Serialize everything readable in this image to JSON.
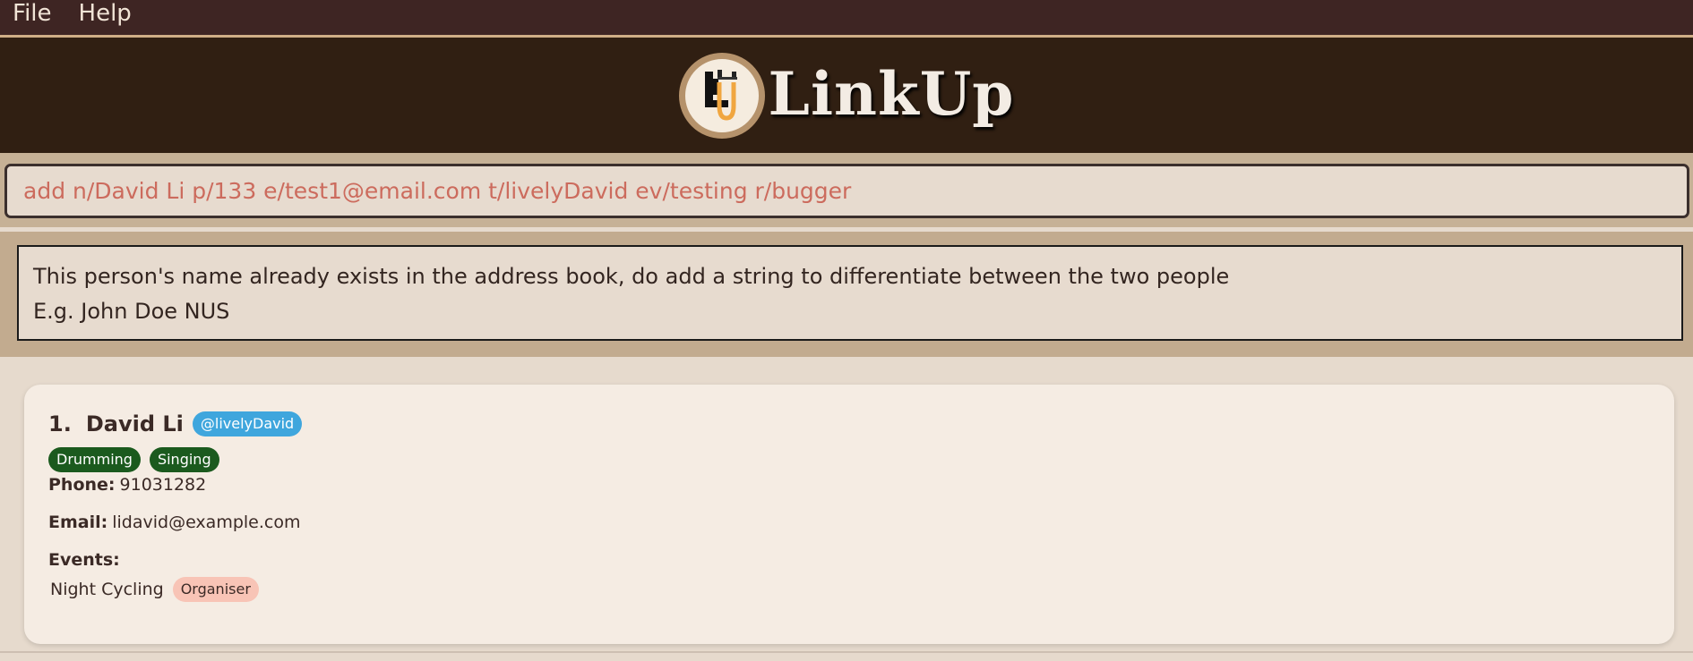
{
  "menu": {
    "file": "File",
    "help": "Help"
  },
  "header": {
    "title": "LinkUp",
    "logo_letters": "LU"
  },
  "command": {
    "value": "add n/David Li p/133 e/test1@email.com t/livelyDavid ev/testing r/bugger"
  },
  "result": {
    "line1": "This person's name already exists in the address book, do add a string to differentiate between the two people",
    "line2": "E.g. John Doe NUS"
  },
  "persons": [
    {
      "index": "1.",
      "name": "David Li",
      "handle": "@livelyDavid",
      "tags": [
        "Drumming",
        "Singing"
      ],
      "phone_label": "Phone:",
      "phone": "91031282",
      "email_label": "Email:",
      "email": "lidavid@example.com",
      "events_label": "Events:",
      "events": [
        {
          "name": "Night Cycling",
          "role": "Organiser"
        }
      ]
    }
  ],
  "colors": {
    "menubar": "#3e2523",
    "header": "#301f12",
    "command_text": "#cc6b5d",
    "handle_badge": "#3fa6dd",
    "tag_badge": "#1b5a1e",
    "role_badge": "#f8c4b6"
  }
}
